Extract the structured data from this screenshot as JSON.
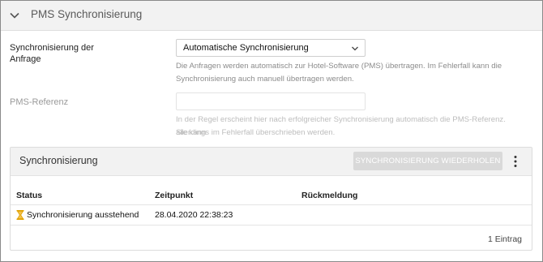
{
  "section": {
    "title": "PMS Synchronisierung"
  },
  "form": {
    "sync_label": "Synchronisierung der Anfrage",
    "sync_value": "Automatische Synchronisierung",
    "sync_help_line1": "Die Anfragen werden automatisch zur Hotel-Software (PMS) übertragen. Im Fehlerfall kann die",
    "sync_help_line2": "Synchronisierung auch manuell übertragen werden.",
    "pms_ref_label": "PMS-Referenz",
    "pms_ref_value": "",
    "pms_ref_help_line1": "In der Regel erscheint hier nach erfolgreicher Synchronisierung automatisch die PMS-Referenz. Sie kann",
    "pms_ref_help_line2": "allerdings im Fehlerfall überschrieben werden."
  },
  "card": {
    "title": "Synchronisierung",
    "retry_button": "SYNCHRONISIERUNG WIEDERHOLEN",
    "columns": [
      "Status",
      "Zeitpunkt",
      "Rückmeldung"
    ],
    "rows": [
      {
        "status": "Synchronisierung ausstehend",
        "zeitpunkt": "28.04.2020 22:38:23",
        "rueckmeldung": ""
      }
    ],
    "count": "1 Eintrag"
  },
  "colors": {
    "hourglass": "#e0a100",
    "header_bg": "#f2f2f2",
    "disabled_button": "#d9d9d9"
  },
  "icons": {
    "collapse": "chevron-down-icon",
    "select": "chevron-down-icon",
    "menu": "more-vertical-icon",
    "status": "hourglass-icon"
  }
}
